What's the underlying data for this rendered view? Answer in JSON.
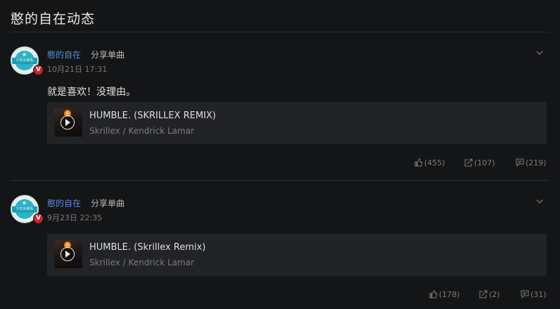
{
  "page": {
    "title": "憨的自在动态"
  },
  "posts": [
    {
      "author": "憨的自在",
      "action": "分享单曲",
      "time": "10月21日 17:31",
      "text": "就是喜欢！没理由。",
      "song": {
        "title": "HUMBLE. (SKRILLEX REMIX)",
        "artist": "Skrillex / Kendrick Lamar"
      },
      "stats": {
        "likes": "(455)",
        "shares": "(107)",
        "comments": "(219)"
      }
    },
    {
      "author": "憨的自在",
      "action": "分享单曲",
      "time": "9月23日 22:35",
      "text": "",
      "song": {
        "title": "HUMBLE. (Skrillex Remix)",
        "artist": "Skrillex / Kendrick Lamar"
      },
      "stats": {
        "likes": "(178)",
        "shares": "(2)",
        "comments": "(31)"
      }
    }
  ],
  "avatar_text": "少年先锋队",
  "badge": "V",
  "icons": {
    "like": "thumb-up-icon",
    "share": "share-icon",
    "comment": "comment-icon",
    "expand": "chevron-down-icon",
    "play": "play-icon"
  },
  "colors": {
    "background": "#141517",
    "card": "#212326",
    "author": "#5b8dd6",
    "badge": "#c4262b"
  }
}
